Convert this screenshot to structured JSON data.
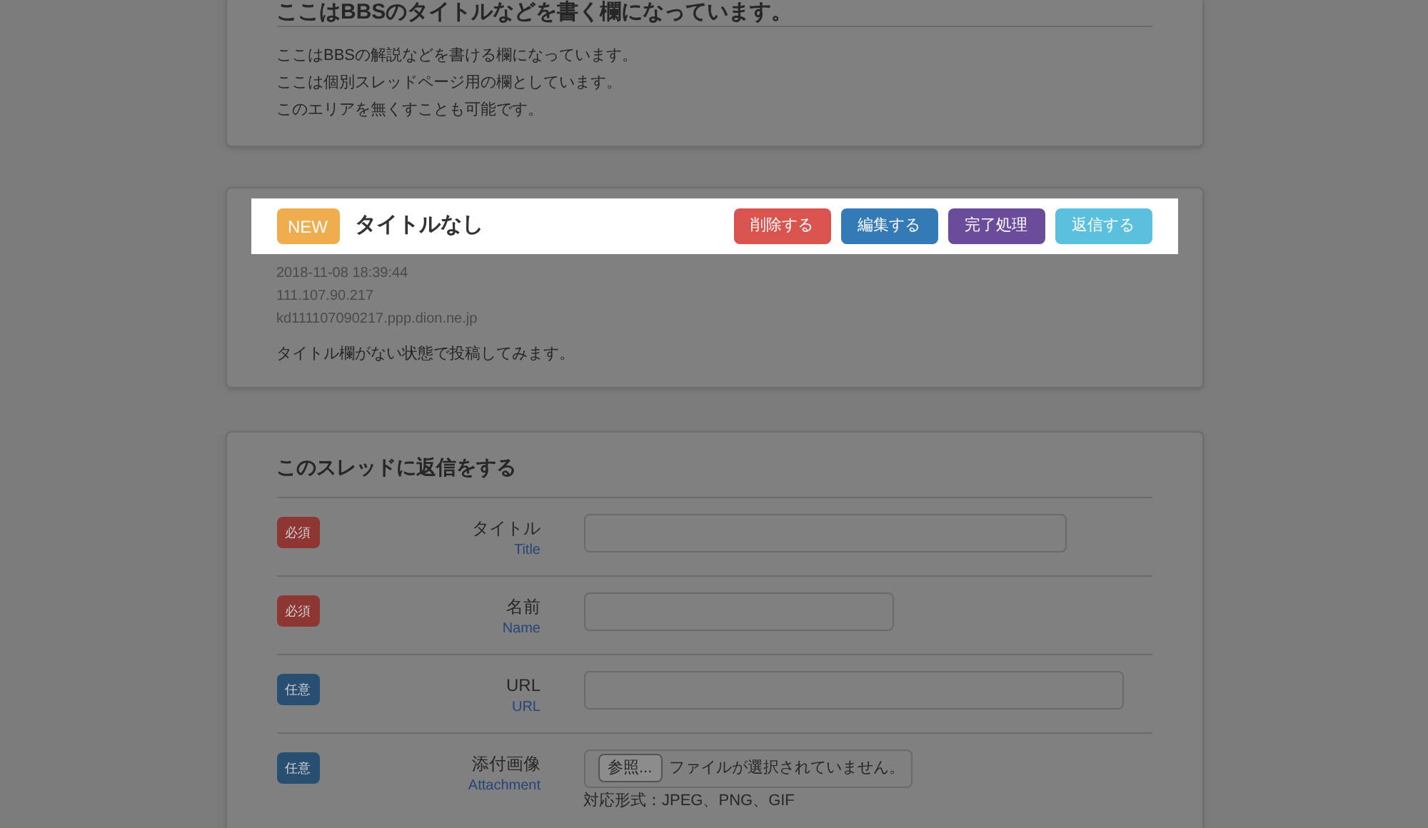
{
  "intro_card": {
    "title": "ここはBBSのタイトルなどを書く欄になっています。",
    "paragraphs": [
      "ここはBBSの解説などを書ける欄になっています。",
      "ここは個別スレッドページ用の欄としています。",
      "このエリアを無くすことも可能です。"
    ]
  },
  "post": {
    "badge": "NEW",
    "title": "タイトルなし",
    "buttons": [
      {
        "label": "削除する",
        "kind": "danger"
      },
      {
        "label": "編集する",
        "kind": "primary"
      },
      {
        "label": "完了処理",
        "kind": "purple"
      },
      {
        "label": "返信する",
        "kind": "info"
      }
    ],
    "date": "2018-11-08 18:39:44",
    "ip": "111.107.90.217",
    "host": "kd111107090217.ppp.dion.ne.jp",
    "body": "タイトル欄がない状態で投稿してみます。"
  },
  "reply_form": {
    "title": "このスレッドに返信をする",
    "fields": [
      {
        "kind": "text",
        "badge": {
          "label": "必須",
          "kind": "required"
        },
        "label": "タイトル",
        "sublabel": "Title"
      },
      {
        "kind": "text",
        "badge": {
          "label": "必須",
          "kind": "required"
        },
        "label": "名前",
        "sublabel": "Name"
      },
      {
        "kind": "text",
        "badge": {
          "label": "任意",
          "kind": "optional"
        },
        "label": "URL",
        "sublabel": "URL"
      },
      {
        "kind": "file",
        "badge": {
          "label": "任意",
          "kind": "optional"
        },
        "label": "添付画像",
        "sublabel": "Attachment",
        "button": "参照...",
        "file_status": "ファイルが選択されていません。",
        "note": "対応形式：JPEG、PNG、GIF"
      }
    ]
  }
}
